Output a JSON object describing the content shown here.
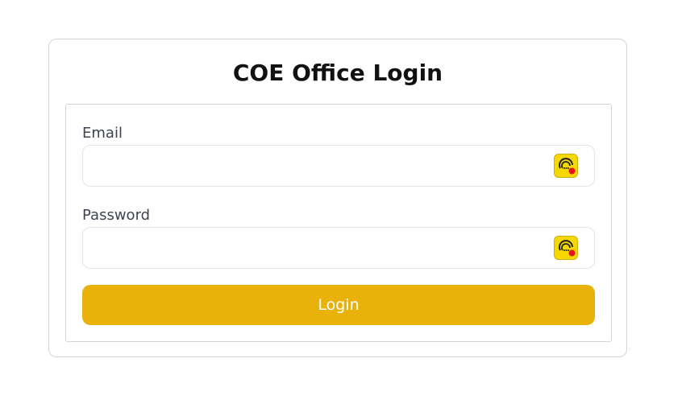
{
  "page": {
    "title": "COE Office Login"
  },
  "form": {
    "email": {
      "label": "Email",
      "value": "",
      "placeholder": ""
    },
    "password": {
      "label": "Password",
      "value": "",
      "placeholder": ""
    },
    "submit_label": "Login"
  },
  "icons": {
    "field_extension_icon": "password-manager-extension-icon"
  },
  "colors": {
    "accent": "#e8b20a",
    "extension_icon_bg": "#f5d800",
    "extension_icon_dot": "#e0181c"
  }
}
